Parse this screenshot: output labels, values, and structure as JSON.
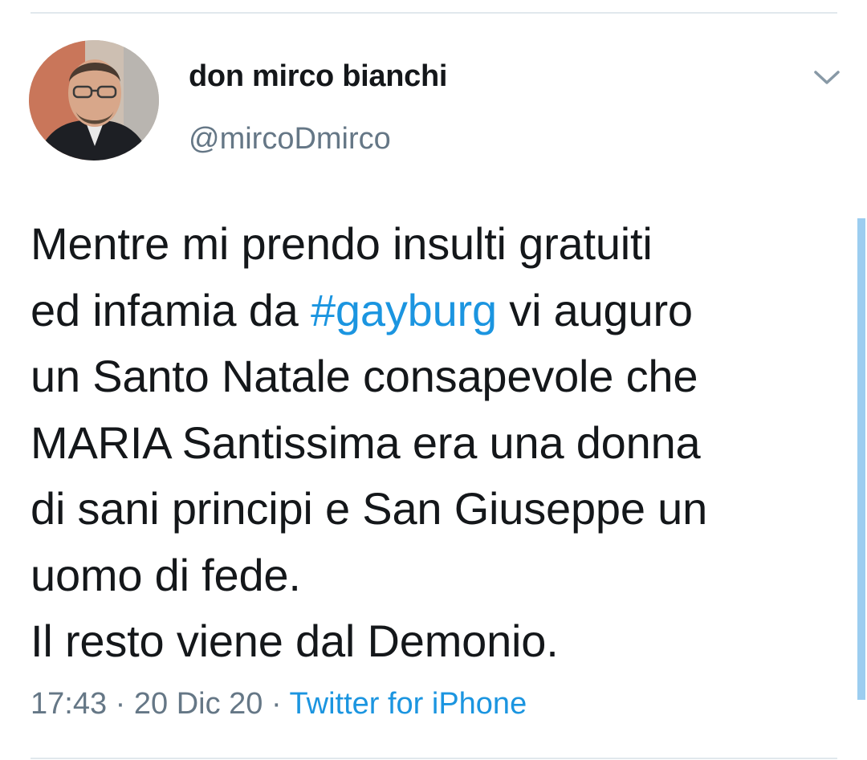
{
  "tweet": {
    "author": {
      "display_name": "don mirco bianchi",
      "handle": "@mircoDmirco"
    },
    "text_lines": [
      [
        "Mentre mi prendo insulti gratuiti"
      ],
      [
        "ed infamia da ",
        "#gayburg",
        " vi auguro"
      ],
      [
        "un Santo Natale consapevole che"
      ],
      [
        "MARIA Santissima era una donna"
      ],
      [
        "di sani principi e San Giuseppe un"
      ],
      [
        "uomo di fede."
      ],
      [
        "Il resto viene dal Demonio."
      ]
    ],
    "hashtag": "#gayburg",
    "time": "17:43",
    "date": "20 Dic 20",
    "separator": "·",
    "source": "Twitter for iPhone"
  },
  "colors": {
    "text": "#14171a",
    "secondary": "#657786",
    "link": "#1b95e0",
    "divider": "#e1e8ed"
  },
  "icons": {
    "menu": "chevron-down-icon",
    "avatar": "profile-photo"
  }
}
